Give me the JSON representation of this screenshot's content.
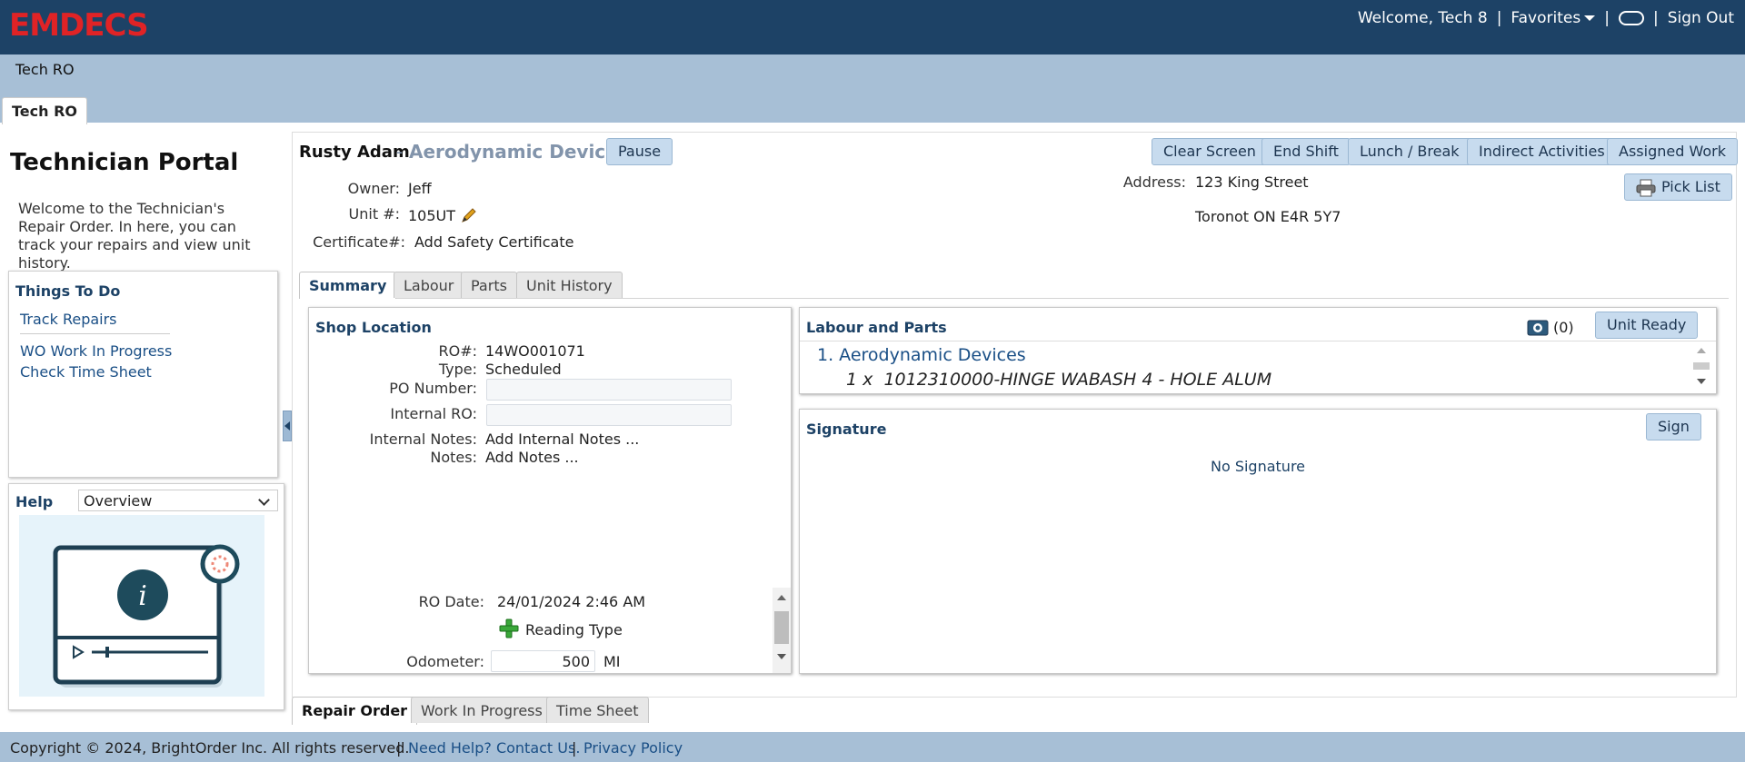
{
  "header": {
    "logo_text": "EMDECS",
    "welcome": "Welcome, Tech 8",
    "sep1": "|",
    "favorites": "Favorites",
    "sep2": "|",
    "sep3": "|",
    "sign_out": "Sign Out"
  },
  "subbar": {
    "title": "Tech RO",
    "tab_label": "Tech RO"
  },
  "portal": {
    "title": "Technician Portal",
    "description": "Welcome to the Technician's Repair Order. In here, you can track your repairs and view unit history.",
    "todo_title": "Things To Do",
    "todo_items": [
      "Track Repairs",
      "WO Work In Progress",
      "Check Time Sheet"
    ],
    "help_title": "Help",
    "help_selected": "Overview"
  },
  "ro": {
    "tech_name": "Rusty Adam",
    "dash": "-",
    "job_name": "Aerodynamic Devices",
    "pause": "Pause",
    "actions": [
      "Clear Screen",
      "End Shift",
      "Lunch / Break",
      "Indirect Activities",
      "Assigned Work"
    ],
    "pick_list": "Pick List",
    "owner_label": "Owner:",
    "owner_value": "Jeff",
    "unit_label": "Unit #:",
    "unit_value": "105UT",
    "cert_label": "Certificate#:",
    "cert_value": "Add Safety Certificate",
    "address_label": "Address:",
    "address_line1": "123 King Street",
    "address_line2": "Toronot ON E4R 5Y7"
  },
  "tabs": [
    "Summary",
    "Labour",
    "Parts",
    "Unit History"
  ],
  "shop": {
    "title": "Shop Location",
    "ro_label": "RO#:",
    "ro_value": "14WO001071",
    "type_label": "Type:",
    "type_value": "Scheduled",
    "po_label": "PO Number:",
    "po_value": "",
    "internal_ro_label": "Internal RO:",
    "internal_ro_value": "",
    "internal_notes_label": "Internal Notes:",
    "internal_notes_value": "Add Internal Notes ...",
    "notes_label": "Notes:",
    "notes_value": "Add Notes ...",
    "ro_date_label": "RO Date:",
    "ro_date_value": "24/01/2024 2:46 AM",
    "reading_type": "Reading Type",
    "odometer_label": "Odometer:",
    "odometer_value": "500",
    "odometer_unit": "MI"
  },
  "labour_parts": {
    "title": "Labour and Parts",
    "camera_count": "(0)",
    "unit_ready": "Unit Ready",
    "item_title": "1. Aerodynamic Devices",
    "item_detail": "1 x  1012310000-HINGE WABASH 4 - HOLE ALUM"
  },
  "signature": {
    "title": "Signature",
    "sign": "Sign",
    "status": "No Signature"
  },
  "bottom_tabs": [
    "Repair Order",
    "Work In Progress",
    "Time Sheet"
  ],
  "footer": {
    "copyright": "Copyright © 2024, BrightOrder Inc. All rights reserved.",
    "sep1": "|",
    "help": "Need Help? Contact Us.",
    "sep2": "|",
    "privacy": "Privacy Policy"
  },
  "colors": {
    "header_bg": "#1d4266",
    "logo": "#e02326",
    "link": "#1a4f86",
    "button": "#c7dbee"
  }
}
